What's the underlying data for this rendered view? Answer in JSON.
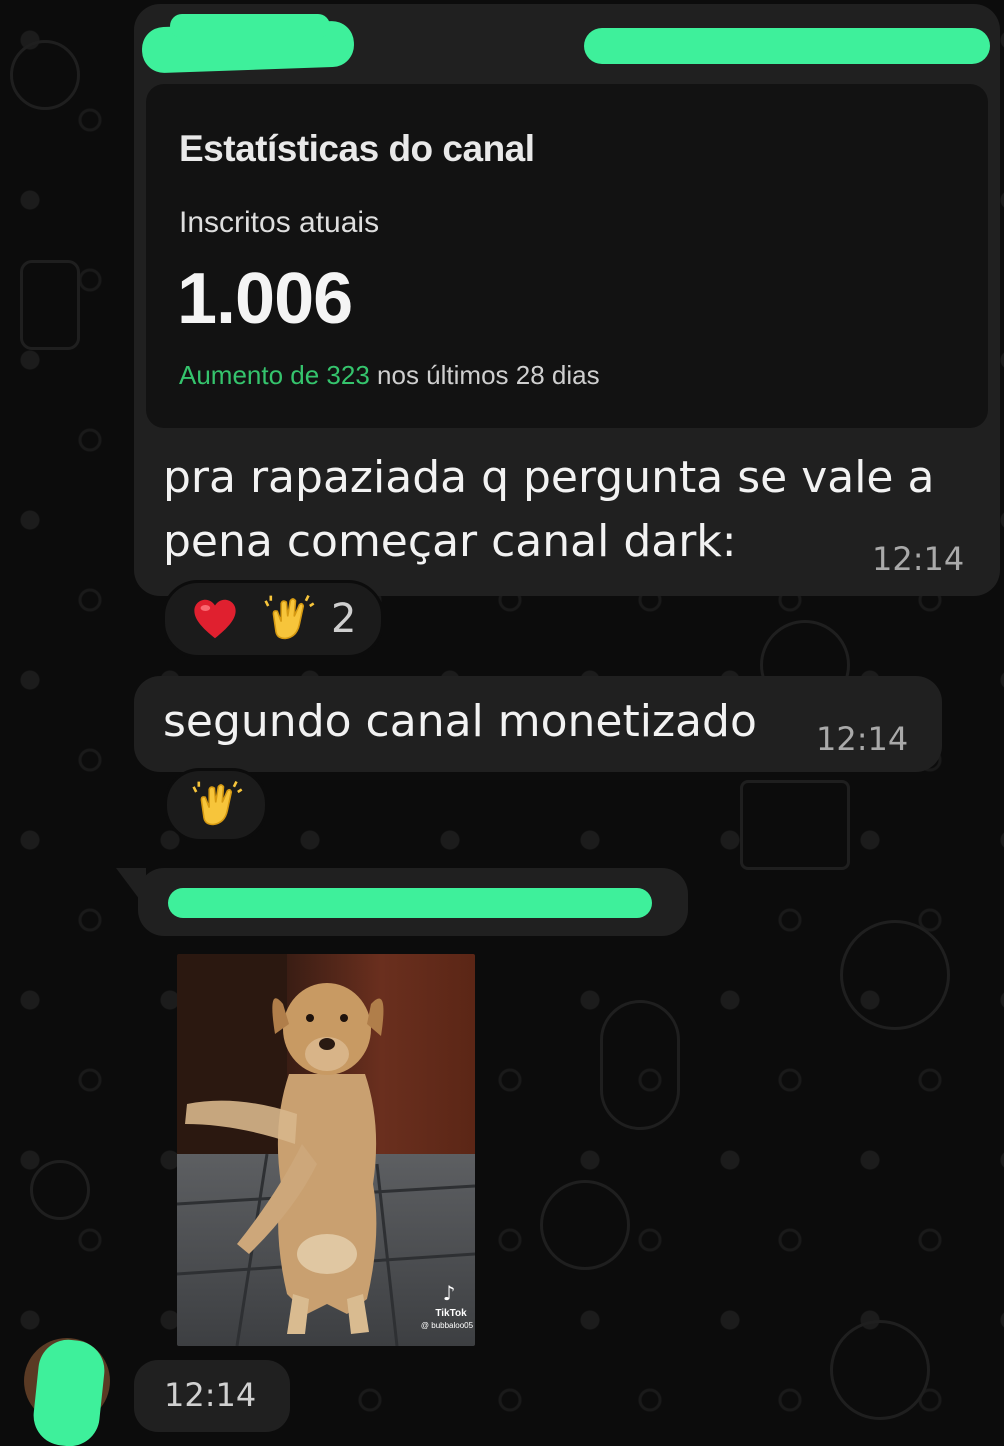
{
  "messages": [
    {
      "card": {
        "title": "Estatísticas do canal",
        "label": "Inscritos atuais",
        "count": "1.006",
        "growth_highlight": "Aumento de 323",
        "growth_rest": " nos últimos 28 dias"
      },
      "text_line1": "pra rapaziada q pergunta se vale a",
      "text_line2": "pena começar canal dark:",
      "time": "12:14",
      "reactions": {
        "emoji": [
          "heart",
          "clapping-hands"
        ],
        "count": "2"
      }
    },
    {
      "text": "segundo canal monetizado",
      "time": "12:14",
      "reactions": {
        "emoji": [
          "clapping-hands"
        ]
      }
    },
    {
      "sticker": {
        "watermark_brand": "TikTok",
        "watermark_user": "@ bubbaloo05"
      },
      "time": "12:14"
    }
  ],
  "colors": {
    "background": "#0c0c0c",
    "bubble": "#202020",
    "redaction": "#3ef09b",
    "growth_green": "#35c46d"
  }
}
